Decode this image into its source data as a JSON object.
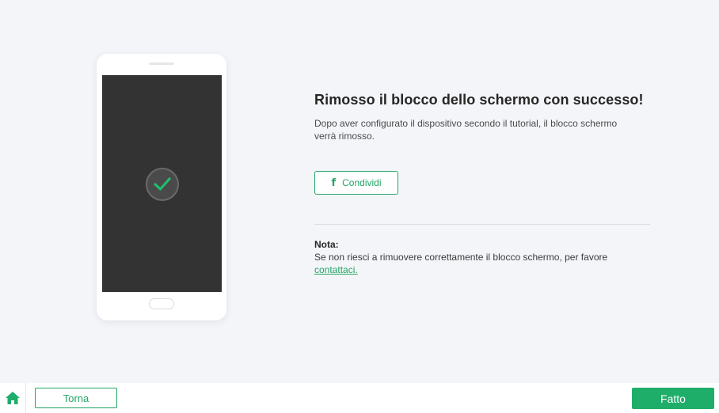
{
  "main": {
    "title": "Rimosso il blocco dello schermo con successo!",
    "description": "Dopo aver configurato il dispositivo secondo il tutorial, il blocco schermo verrà rimosso.",
    "share_button": {
      "icon": "facebook-icon",
      "label": "Condividi"
    },
    "note": {
      "title": "Nota:",
      "text": "Se non riesci a rimuovere correttamente il blocco schermo, per favore",
      "link": "contattaci."
    }
  },
  "footer": {
    "home_icon": "home-icon",
    "back_label": "Torna",
    "done_label": "Fatto"
  },
  "colors": {
    "accent": "#23a566",
    "done_button": "#1fae6a",
    "background": "#f4f5f9",
    "phone_screen": "#333333"
  }
}
